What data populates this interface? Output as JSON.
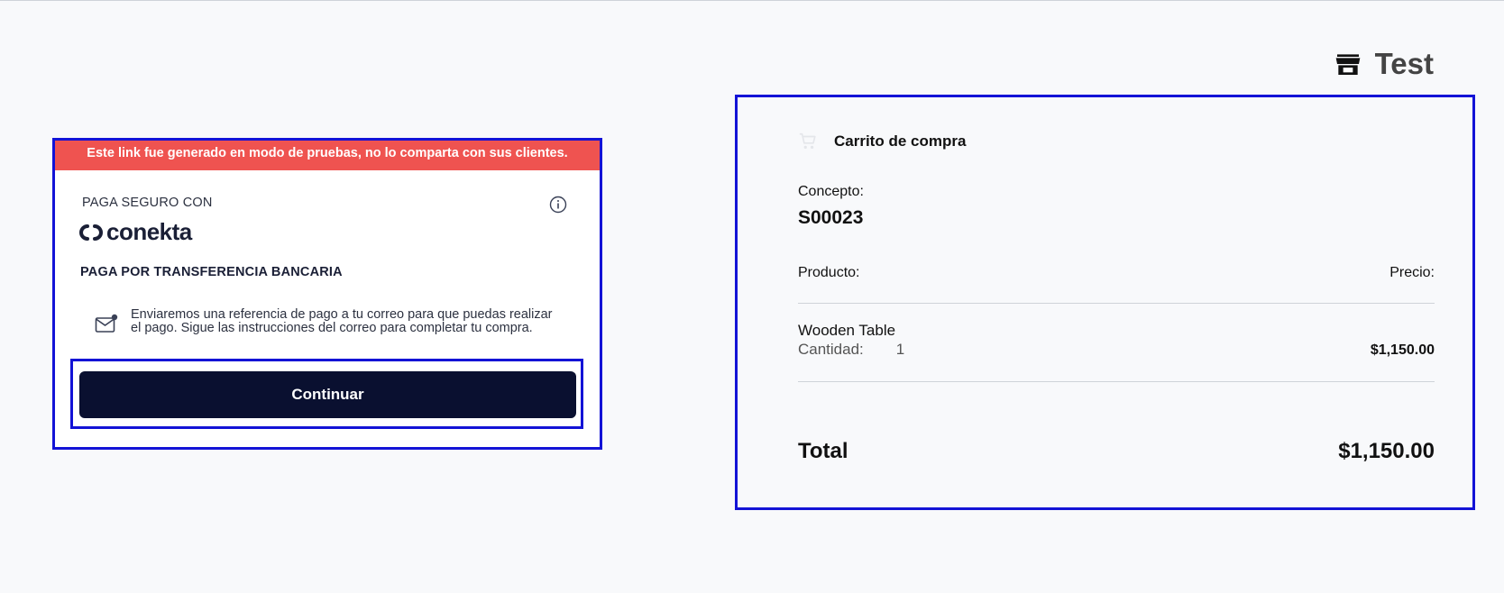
{
  "store": {
    "name": "Test",
    "icon": "store-icon"
  },
  "payment": {
    "test_banner": "Este link fue generado en modo de pruebas, no lo comparta con sus clientes.",
    "pay_safe_label": "PAGA SEGURO CON",
    "brand_name": "conekta",
    "method_title": "PAGA POR TRANSFERENCIA BANCARIA",
    "notice": "Enviaremos una referencia de pago a tu correo para que puedas realizar el pago. Sigue las instrucciones del correo para completar tu compra.",
    "continue_label": "Continuar",
    "icons": [
      "info-icon",
      "mail-icon"
    ]
  },
  "cart": {
    "title": "Carrito de compra",
    "concept_label": "Concepto:",
    "concept_value": "S00023",
    "product_label": "Producto:",
    "price_label": "Precio:",
    "item": {
      "name": "Wooden Table",
      "quantity_label": "Cantidad:",
      "quantity": "1",
      "price": "$1,150.00"
    },
    "total_label": "Total",
    "total_value": "$1,150.00"
  },
  "colors": {
    "banner": "#ef5350",
    "button": "#0a1030",
    "highlight_border": "#1313d6",
    "background": "#f8f9fb"
  }
}
